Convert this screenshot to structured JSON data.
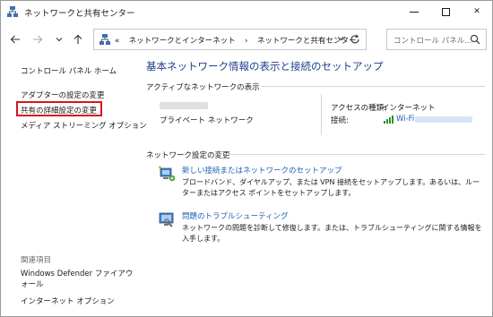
{
  "window": {
    "title": "ネットワークと共有センター",
    "minimize_icon": "minimize-icon",
    "maximize_icon": "maximize-icon",
    "close_glyph": "✕"
  },
  "nav": {
    "back_icon": "back-arrow-icon",
    "forward_icon": "forward-arrow-icon",
    "recent_icon": "chevron-down-icon",
    "up_icon": "up-arrow-icon",
    "address": {
      "prefix": "«",
      "crumbs": [
        "ネットワークとインターネット",
        "ネットワークと共有センター"
      ],
      "separator": "›"
    },
    "search_placeholder": "コントロール パネル..."
  },
  "sidebar": {
    "home": "コントロール パネル ホーム",
    "links": [
      "アダプターの設定の変更",
      "共有の詳細設定の変更",
      "メディア ストリーミング オプション"
    ],
    "highlighted_index": 1,
    "related_heading": "関連項目",
    "related": [
      "Windows Defender ファイアウォール",
      "インターネット オプション"
    ]
  },
  "main": {
    "title": "基本ネットワーク情報の表示と接続のセットアップ",
    "active_heading": "アクティブなネットワークの表示",
    "network": {
      "type": "プライベート ネットワーク",
      "access_label": "アクセスの種類:",
      "access_value": "インターネット",
      "connection_label": "接続:",
      "connection_value": "Wi-Fi"
    },
    "change_heading": "ネットワーク設定の変更",
    "tasks": [
      {
        "icon": "network-setup-icon",
        "label": "新しい接続またはネットワークのセットアップ",
        "description": "ブロードバンド、ダイヤルアップ、または VPN 接続をセットアップします。あるいは、ルーターまたはアクセス ポイントをセットアップします。"
      },
      {
        "icon": "troubleshoot-icon",
        "label": "問題のトラブルシューティング",
        "description": "ネットワークの問題を診断して修復します。または、トラブルシューティングに関する情報を入手します。"
      }
    ]
  },
  "colors": {
    "title_blue": "#1e3d8f",
    "link_blue": "#1a5fb4",
    "highlight_red": "#d9141b"
  }
}
